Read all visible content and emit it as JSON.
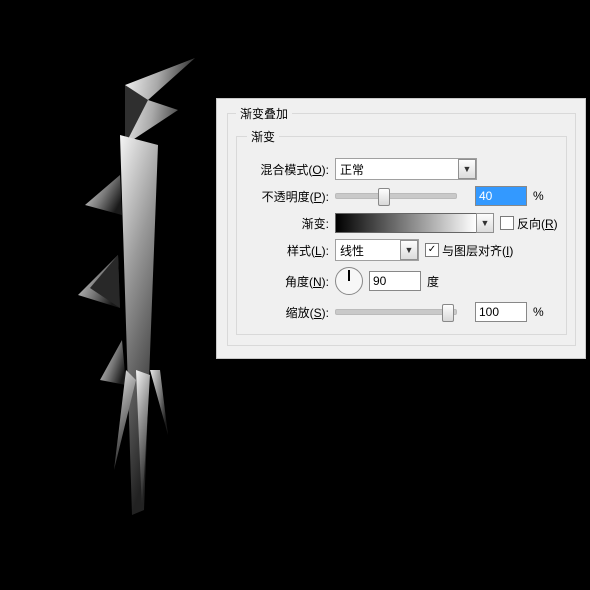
{
  "panel": {
    "outerLegend": "渐变叠加",
    "innerLegend": "渐变",
    "blendMode": {
      "label_pre": "混合模式(",
      "hotkey": "O",
      "label_post": "):",
      "value": "正常"
    },
    "opacity": {
      "label_pre": "不透明度(",
      "hotkey": "P",
      "label_post": "):",
      "value": "40",
      "suffix": "%"
    },
    "gradient": {
      "label": "渐变:",
      "reverse_pre": "反向(",
      "reverse_hot": "R",
      "reverse_post": ")",
      "reverse_checked": false
    },
    "style": {
      "label_pre": "样式(",
      "hotkey": "L",
      "label_post": "):",
      "value": "线性",
      "align_pre": "与图层对齐(",
      "align_hot": "I",
      "align_post": ")",
      "align_checked": true
    },
    "angle": {
      "label_pre": "角度(",
      "hotkey": "N",
      "label_post": "):",
      "value": "90",
      "suffix": "度"
    },
    "scale": {
      "label_pre": "缩放(",
      "hotkey": "S",
      "label_post": "):",
      "value": "100",
      "suffix": "%"
    }
  }
}
